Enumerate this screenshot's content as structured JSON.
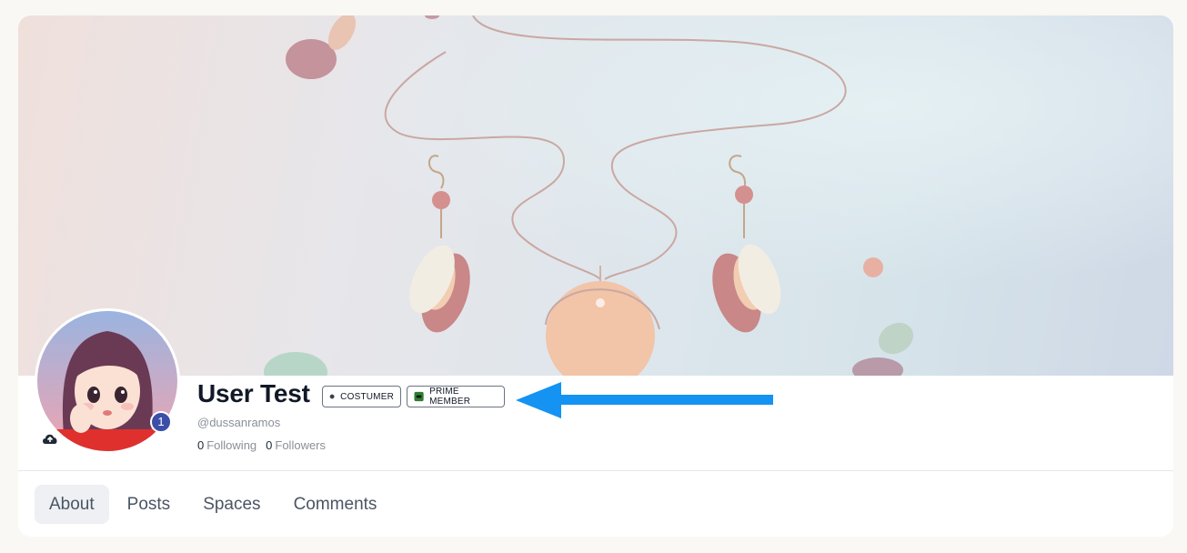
{
  "profile": {
    "name": "User Test",
    "handle": "@dussanramos",
    "notification_count": "1",
    "following_count": "0",
    "following_label": "Following",
    "followers_count": "0",
    "followers_label": "Followers"
  },
  "tags": [
    {
      "label": "COSTUMER",
      "icon": "hexagon-icon"
    },
    {
      "label": "PRIME MEMBER",
      "icon": "prime-badge-icon"
    }
  ],
  "tabs": [
    {
      "label": "About",
      "active": true
    },
    {
      "label": "Posts",
      "active": false
    },
    {
      "label": "Spaces",
      "active": false
    },
    {
      "label": "Comments",
      "active": false
    }
  ],
  "colors": {
    "accent_arrow": "#1493f2",
    "badge_count_bg": "#3b4ea8",
    "tab_active_bg": "#eef0f4"
  },
  "icons": {
    "upload": "cloud-upload-icon",
    "annotation": "arrow-left-icon"
  }
}
